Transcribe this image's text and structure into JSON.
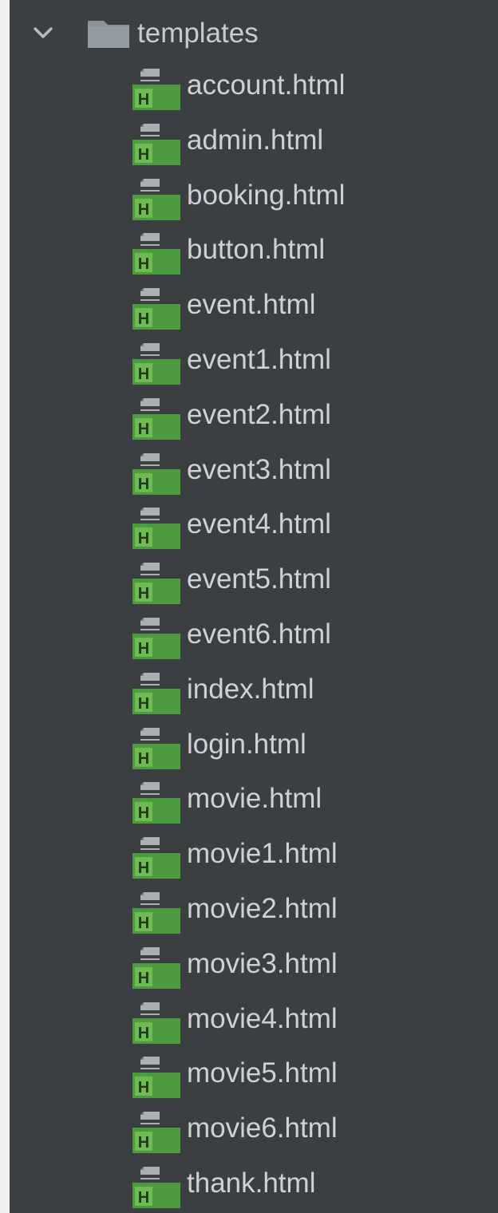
{
  "tree": {
    "folder": {
      "label": "templates",
      "icon": "folder-icon",
      "expand_icon": "chevron-down-icon",
      "expanded": true
    },
    "files": [
      {
        "label": "account.html",
        "icon": "html-file-icon"
      },
      {
        "label": "admin.html",
        "icon": "html-file-icon"
      },
      {
        "label": "booking.html",
        "icon": "html-file-icon"
      },
      {
        "label": "button.html",
        "icon": "html-file-icon"
      },
      {
        "label": "event.html",
        "icon": "html-file-icon"
      },
      {
        "label": "event1.html",
        "icon": "html-file-icon"
      },
      {
        "label": "event2.html",
        "icon": "html-file-icon"
      },
      {
        "label": "event3.html",
        "icon": "html-file-icon"
      },
      {
        "label": "event4.html",
        "icon": "html-file-icon"
      },
      {
        "label": "event5.html",
        "icon": "html-file-icon"
      },
      {
        "label": "event6.html",
        "icon": "html-file-icon"
      },
      {
        "label": "index.html",
        "icon": "html-file-icon"
      },
      {
        "label": "login.html",
        "icon": "html-file-icon"
      },
      {
        "label": "movie.html",
        "icon": "html-file-icon"
      },
      {
        "label": "movie1.html",
        "icon": "html-file-icon"
      },
      {
        "label": "movie2.html",
        "icon": "html-file-icon"
      },
      {
        "label": "movie3.html",
        "icon": "html-file-icon"
      },
      {
        "label": "movie4.html",
        "icon": "html-file-icon"
      },
      {
        "label": "movie5.html",
        "icon": "html-file-icon"
      },
      {
        "label": "movie6.html",
        "icon": "html-file-icon"
      },
      {
        "label": "thank.html",
        "icon": "html-file-icon"
      }
    ]
  },
  "colors": {
    "panel_background": "#3c3f41",
    "text": "#cfd1d3",
    "folder_icon": "#8a9299",
    "html_badge_green": "#4e9a3e",
    "html_badge_letter": "#243a1f",
    "file_page_gray": "#a9b0b5"
  }
}
